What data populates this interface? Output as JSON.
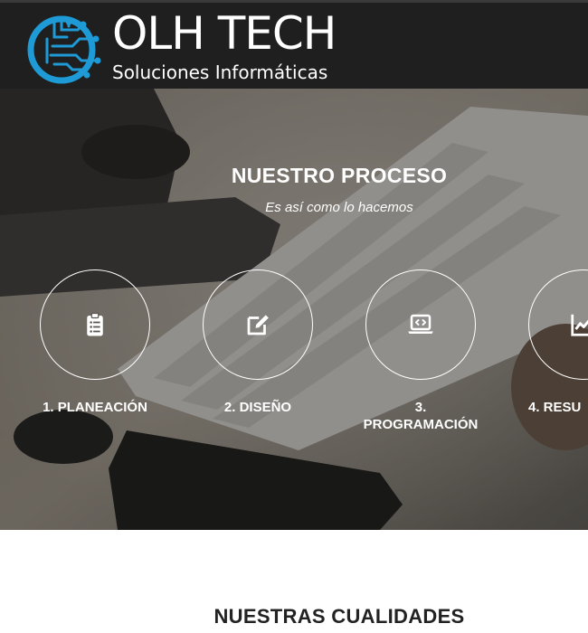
{
  "header": {
    "brand_title": "OLH TECH",
    "brand_subtitle": "Soluciones Informáticas",
    "logo_icon": "circuit-brain-logo",
    "logo_color": "#1e9bd7"
  },
  "hero": {
    "title": "NUESTRO PROCESO",
    "subtitle": "Es así como lo hacemos",
    "steps": [
      {
        "label": "1. PLANEACIÓN",
        "icon": "clipboard-list-icon"
      },
      {
        "label": "2. DISEÑO",
        "icon": "edit-icon"
      },
      {
        "label": "3.\nPROGRAMACIÓN",
        "icon": "laptop-code-icon"
      },
      {
        "label": "4. RESU",
        "icon": "chart-line-icon"
      }
    ]
  },
  "qualities": {
    "title": "NUESTRAS CUALIDADES"
  }
}
